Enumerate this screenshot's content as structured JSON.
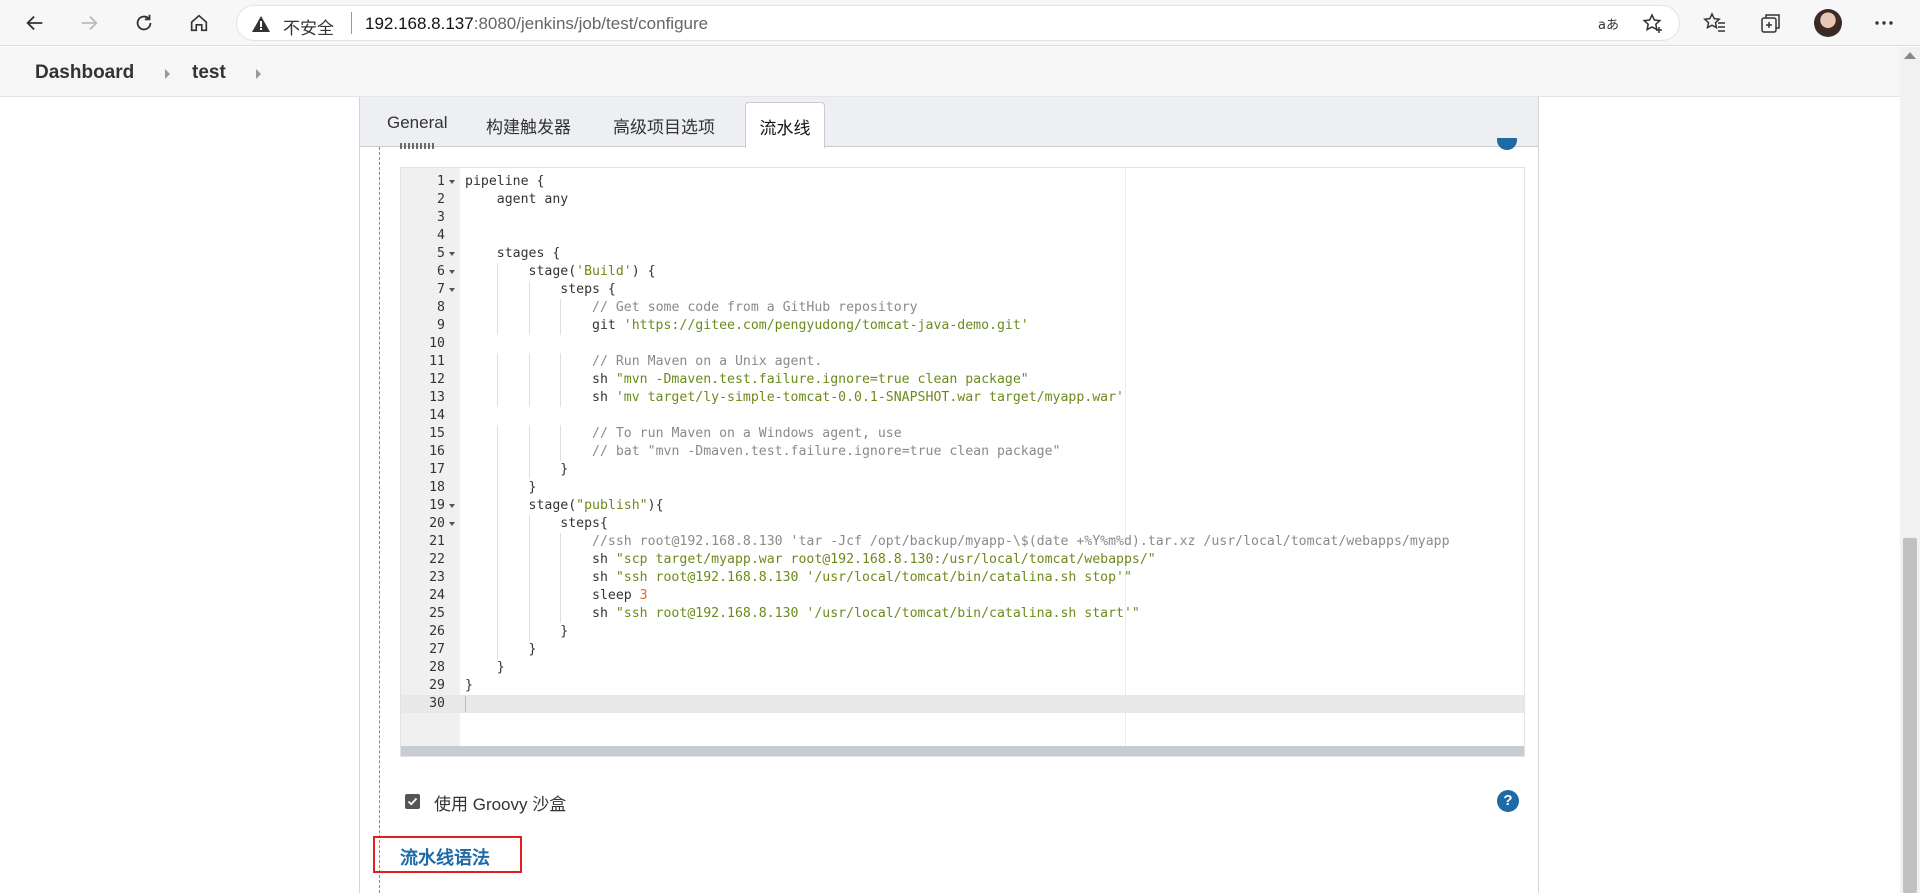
{
  "browser": {
    "insecure_label": "不安全",
    "url_host": "192.168.8.137",
    "url_path": ":8080/jenkins/job/test/configure"
  },
  "breadcrumb": [
    "Dashboard",
    "test"
  ],
  "tabs": [
    {
      "label": "General",
      "active": false
    },
    {
      "label": "构建触发器",
      "active": false
    },
    {
      "label": "高级项目选项",
      "active": false
    },
    {
      "label": "流水线",
      "active": true
    }
  ],
  "editor": {
    "lines": [
      "pipeline {",
      "    agent any",
      "",
      "",
      "    stages {",
      "        stage('Build') {",
      "            steps {",
      "                // Get some code from a GitHub repository",
      "                git 'https://gitee.com/pengyudong/tomcat-java-demo.git'",
      "",
      "                // Run Maven on a Unix agent.",
      "                sh \"mvn -Dmaven.test.failure.ignore=true clean package\"",
      "                sh 'mv target/ly-simple-tomcat-0.0.1-SNAPSHOT.war target/myapp.war'",
      "",
      "                // To run Maven on a Windows agent, use",
      "                // bat \"mvn -Dmaven.test.failure.ignore=true clean package\"",
      "            }",
      "        }",
      "        stage(\"publish\"){",
      "            steps{",
      "                //ssh root@192.168.8.130 'tar -Jcf /opt/backup/myapp-\\$(date +%Y%m%d).tar.xz /usr/local/tomcat/webapps/myapp",
      "                sh \"scp target/myapp.war root@192.168.8.130:/usr/local/tomcat/webapps/\"",
      "                sh \"ssh root@192.168.8.130 '/usr/local/tomcat/bin/catalina.sh stop'\"",
      "                sleep 3",
      "                sh \"ssh root@192.168.8.130 '/usr/local/tomcat/bin/catalina.sh start'\"",
      "            }",
      "        }",
      "    }",
      "}",
      ""
    ],
    "fold_lines": [
      1,
      5,
      6,
      7,
      19,
      20
    ],
    "active_line": 30
  },
  "sandbox": {
    "label": "使用 Groovy 沙盒",
    "checked": true
  },
  "help_symbol": "?",
  "pipeline_syntax_link": "流水线语法",
  "colors": {
    "link": "#1d6aa5",
    "highlight_box": "#e02020",
    "string": "#6c8a1c",
    "comment": "#8a8a8a",
    "number": "#e4662a"
  }
}
